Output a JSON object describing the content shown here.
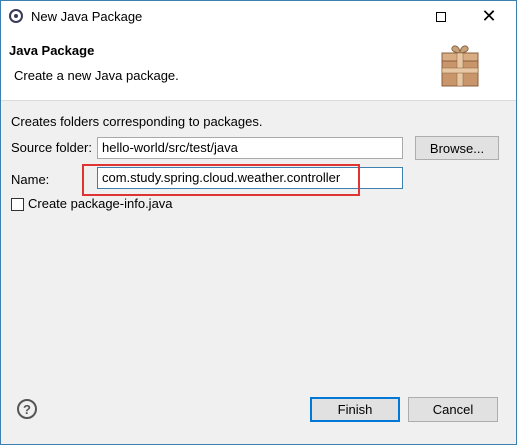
{
  "window": {
    "title": "New Java Package",
    "maximize_icon": "maximize-icon",
    "close_glyph": "✕"
  },
  "banner": {
    "title": "Java Package",
    "description": "Create a new Java package.",
    "icon": "package-gift-icon"
  },
  "form": {
    "info": "Creates folders corresponding to packages.",
    "source_folder_label": "Source folder:",
    "source_folder_value": "hello-world/src/test/java",
    "browse_label": "Browse...",
    "name_label": "Name:",
    "name_value": "com.study.spring.cloud.weather.controller",
    "create_package_info_label": "Create package-info.java",
    "create_package_info_checked": false,
    "highlight_color": "#e03434"
  },
  "footer": {
    "help_glyph": "?",
    "finish_label": "Finish",
    "cancel_label": "Cancel"
  }
}
